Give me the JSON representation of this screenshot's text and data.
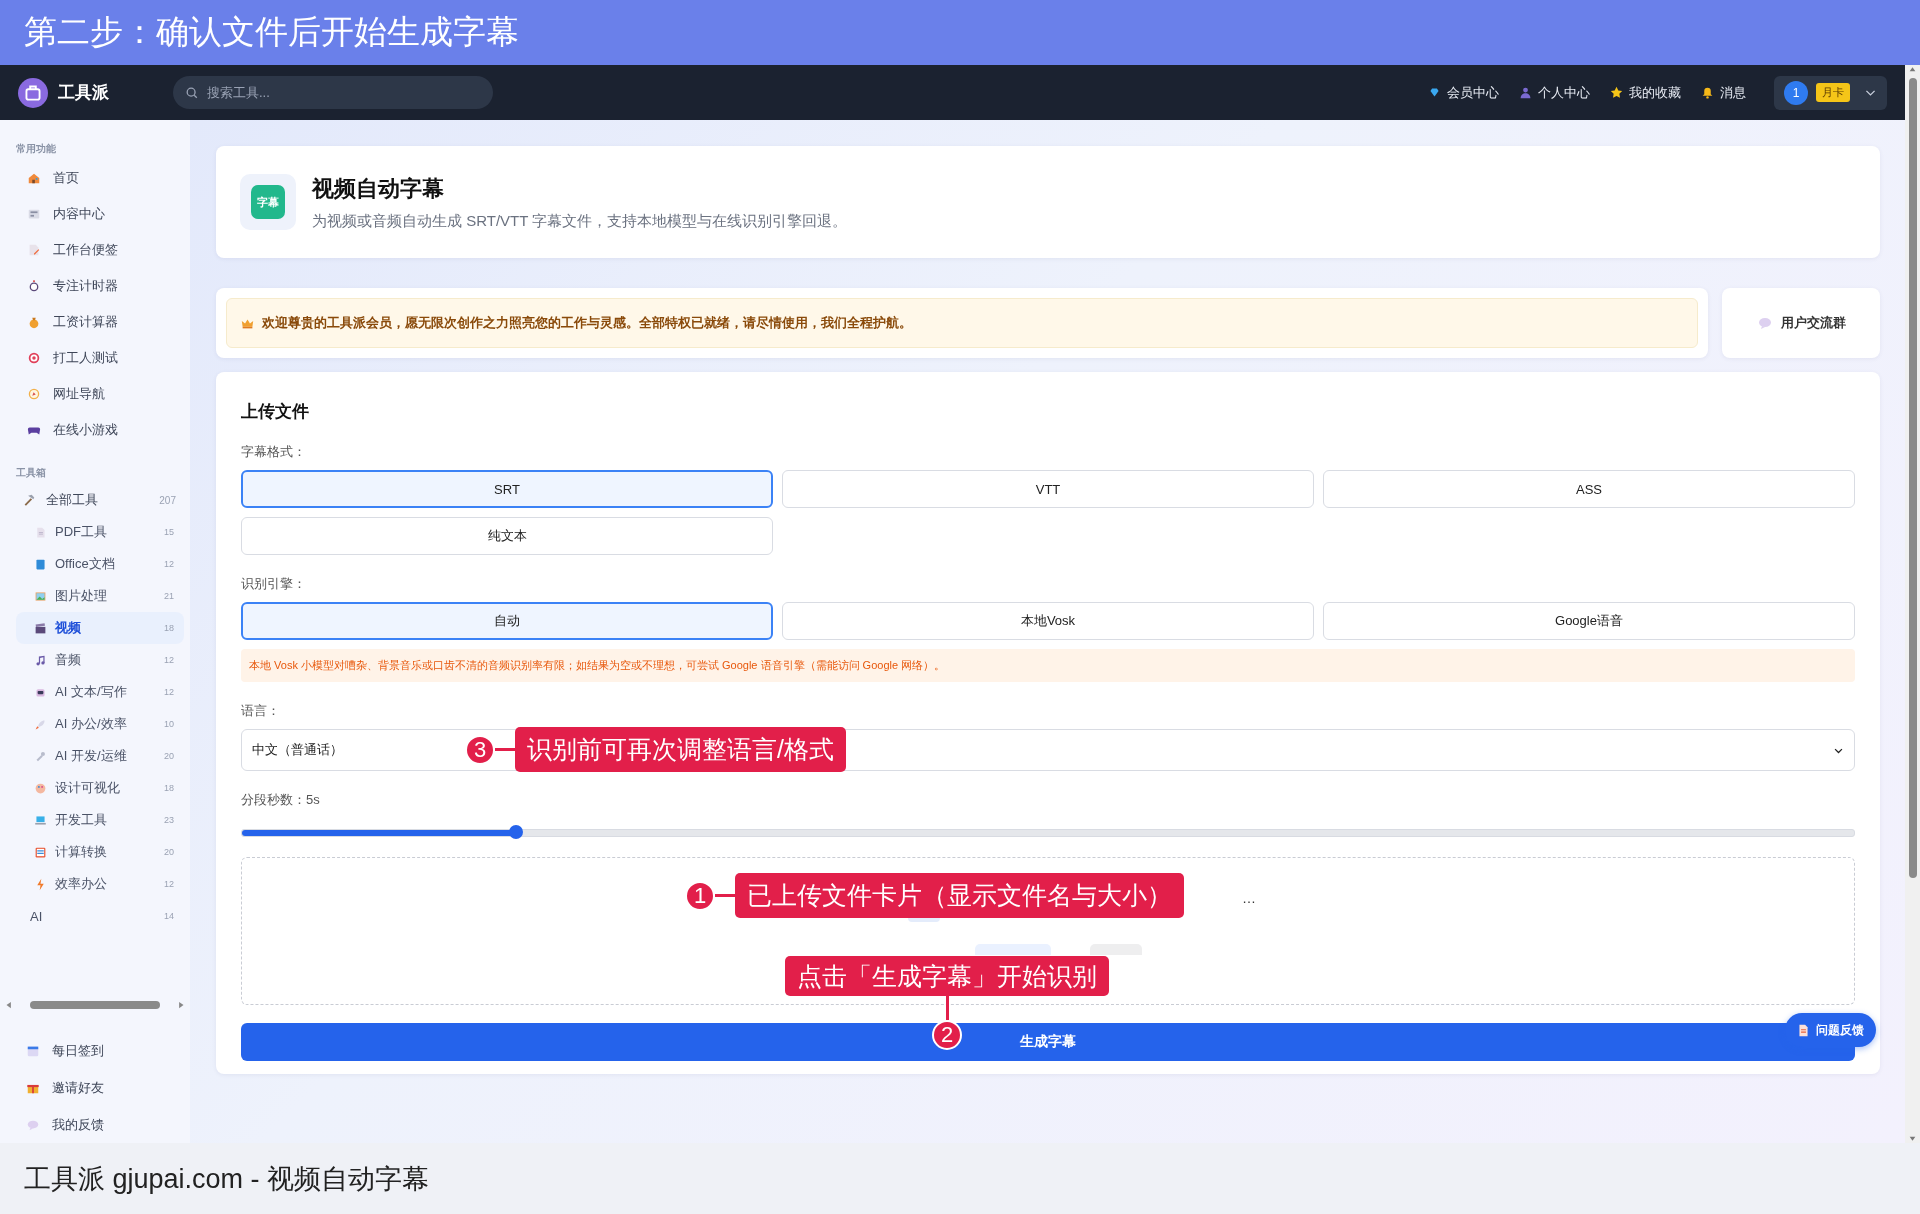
{
  "banner": {
    "title": "第二步：确认文件后开始生成字幕"
  },
  "navbar": {
    "brand": "工具派",
    "search": {
      "placeholder": "搜索工具..."
    },
    "links": [
      {
        "label": "会员中心"
      },
      {
        "label": "个人中心"
      },
      {
        "label": "我的收藏"
      },
      {
        "label": "消息"
      }
    ],
    "user": {
      "badge": "1",
      "tag": "月卡"
    }
  },
  "sidebar": {
    "sections": [
      {
        "heading": "常用功能",
        "items": [
          {
            "label": "首页",
            "selected": false
          },
          {
            "label": "内容中心",
            "selected": false
          },
          {
            "label": "工作台便签",
            "selected": false
          },
          {
            "label": "专注计时器",
            "selected": false
          },
          {
            "label": "工资计算器",
            "selected": false
          },
          {
            "label": "打工人测试",
            "selected": false
          },
          {
            "label": "网址导航",
            "selected": false
          },
          {
            "label": "在线小游戏",
            "selected": false
          }
        ]
      },
      {
        "heading": "工具箱",
        "items": [
          {
            "label": "全部工具",
            "count": "207",
            "selected": false,
            "children": [
              {
                "label": "PDF工具",
                "count": "15",
                "selected": false
              },
              {
                "label": "Office文档",
                "count": "12",
                "selected": false
              },
              {
                "label": "图片处理",
                "count": "21",
                "selected": false
              },
              {
                "label": "视频",
                "count": "18",
                "selected": true
              },
              {
                "label": "音频",
                "count": "12",
                "selected": false
              },
              {
                "label": "AI 文本/写作",
                "count": "12",
                "selected": false
              },
              {
                "label": "AI 办公/效率",
                "count": "10",
                "selected": false
              },
              {
                "label": "AI 开发/运维",
                "count": "20",
                "selected": false
              },
              {
                "label": "设计可视化",
                "count": "18",
                "selected": false
              },
              {
                "label": "开发工具",
                "count": "23",
                "selected": false
              },
              {
                "label": "计算转换",
                "count": "20",
                "selected": false
              },
              {
                "label": "效率办公",
                "count": "12",
                "selected": false
              },
              {
                "label": "AI",
                "count": "14",
                "selected": false
              }
            ]
          }
        ]
      }
    ],
    "bottom_items": [
      {
        "label": "每日签到"
      },
      {
        "label": "邀请好友"
      },
      {
        "label": "我的反馈"
      }
    ]
  },
  "tool": {
    "icon_text": "字幕",
    "title": "视频自动字幕",
    "description": "为视频或音频自动生成 SRT/VTT 字幕文件，支持本地模型与在线识别引擎回退。"
  },
  "notice": {
    "text": "欢迎尊贵的工具派会员，愿无限次创作之力照亮您的工作与灵感。全部特权已就绪，请尽情使用，我们全程护航。",
    "group_button": "用户交流群"
  },
  "upload": {
    "title": "上传文件",
    "format_label": "字幕格式：",
    "formats": [
      {
        "label": "SRT",
        "selected": true
      },
      {
        "label": "VTT",
        "selected": false
      },
      {
        "label": "ASS",
        "selected": false
      },
      {
        "label": "纯文本",
        "selected": false
      }
    ],
    "engine_label": "识别引擎：",
    "engines": [
      {
        "label": "自动",
        "selected": true
      },
      {
        "label": "本地Vosk",
        "selected": false
      },
      {
        "label": "Google语音",
        "selected": false
      }
    ],
    "warning": "本地 Vosk 小模型对嘈杂、背景音乐或口齿不清的音频识别率有限；如结果为空或不理想，可尝试 Google 语音引擎（需能访问 Google 网络）。",
    "language_label": "语言：",
    "language": "中文（普通话）",
    "segment_label": "分段秒数：5s",
    "segment": {
      "level": 0.17
    },
    "file": {
      "name_tail": "…"
    },
    "generate_button": "生成字幕"
  },
  "feedback_button": "问题反馈",
  "annotations": [
    {
      "kind": "side",
      "number": "3",
      "text": "识别前可再次调整语言/格式"
    },
    {
      "kind": "side",
      "number": "1",
      "text": "已上传文件卡片（显示文件名与大小）"
    },
    {
      "kind": "below",
      "number": "2",
      "text": "点击「生成字幕」开始识别"
    }
  ],
  "caption": "工具派 gjupai.com - 视频自动字幕"
}
